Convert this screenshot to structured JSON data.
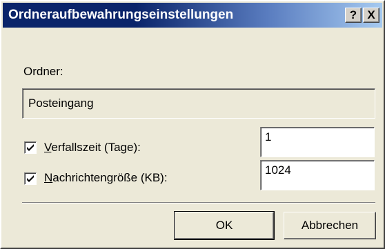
{
  "window": {
    "title": "Ordneraufbewahrungseinstellungen",
    "help_label": "?",
    "close_label": "X"
  },
  "folder": {
    "label": "Ordner:",
    "value": "Posteingang"
  },
  "expiry": {
    "checked": true,
    "label_mnemonic": "V",
    "label_rest": "erfallszeit (Tage):",
    "value": "1"
  },
  "message_size": {
    "checked": true,
    "label_mnemonic": "N",
    "label_rest": "achrichtengröße (KB):",
    "value": "1024"
  },
  "buttons": {
    "ok": "OK",
    "cancel": "Abbrechen"
  },
  "colors": {
    "titlebar_start": "#0a246a",
    "titlebar_end": "#a6caf0",
    "face": "#ece9d8"
  }
}
